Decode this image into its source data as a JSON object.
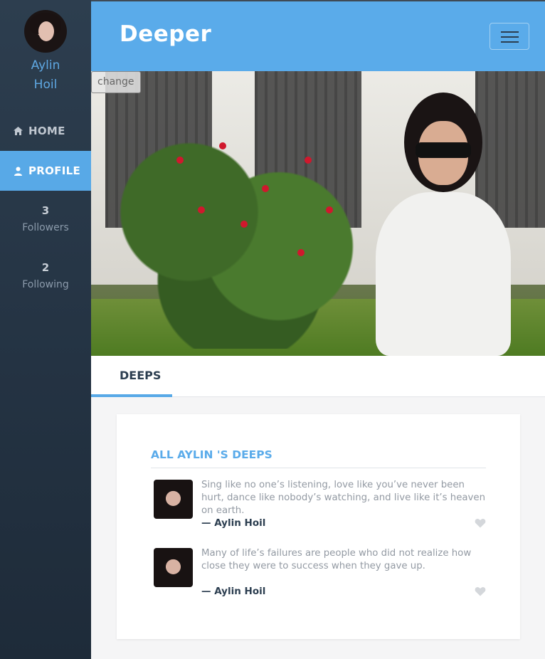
{
  "app": {
    "brand": "Deeper"
  },
  "sidebar": {
    "user": {
      "first_name": "Aylin",
      "last_name": "Hoil"
    },
    "nav": [
      {
        "label": "HOME",
        "icon": "home-icon"
      },
      {
        "label": "PROFILE",
        "icon": "user-icon",
        "active": true
      }
    ],
    "stats": [
      {
        "count": "3",
        "label": "Followers"
      },
      {
        "count": "2",
        "label": "Following"
      }
    ]
  },
  "cover": {
    "change_label": "change"
  },
  "tabs": [
    {
      "label": "DEEPS",
      "active": true
    }
  ],
  "deeps_card": {
    "title": "ALL AYLIN 'S DEEPS",
    "items": [
      {
        "text": "Sing like no one’s listening, love like you’ve never been hurt, dance like nobody’s watching, and live like it’s heaven on earth.",
        "author": "— Aylin Hoil",
        "liked": false
      },
      {
        "text": "Many of life’s failures are people who did not realize how close they were to success when they gave up.",
        "author": "— Aylin Hoil",
        "liked": false
      }
    ]
  },
  "colors": {
    "accent": "#5aabea",
    "sidebar_bg": "#2d3e4f",
    "dark_text": "#2c3e50"
  }
}
